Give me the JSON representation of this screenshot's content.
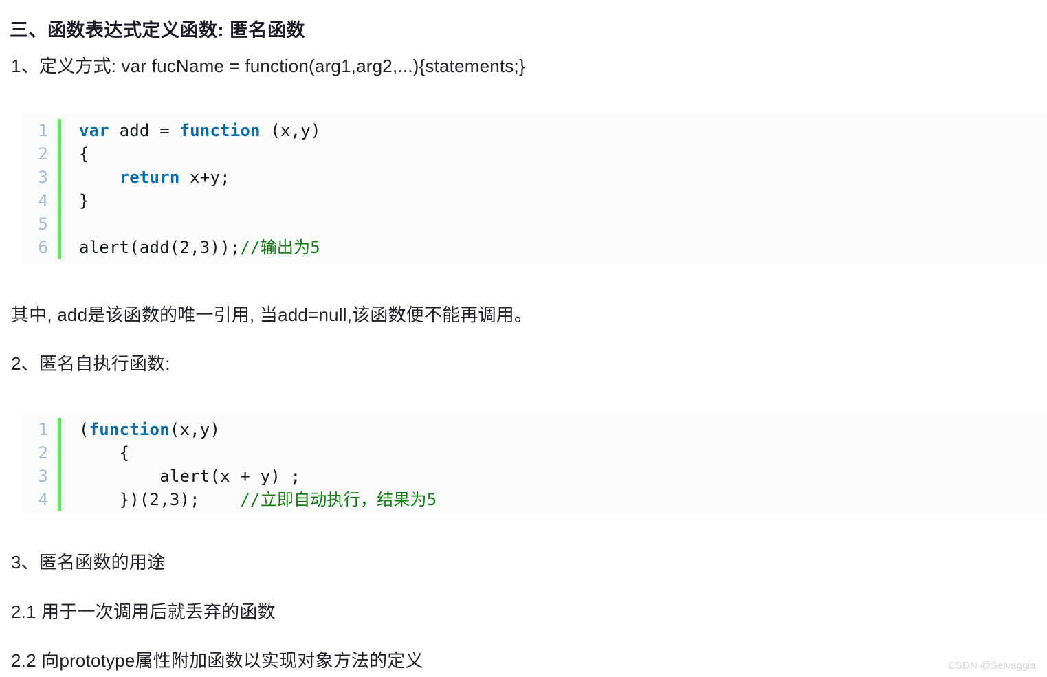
{
  "document": {
    "title": "三、函数表达式定义函数: 匿名函数",
    "paragraphs": {
      "definition_line": "1、定义方式: var fucName = function(arg1,arg2,...){statements;}",
      "note_line": "其中, add是该函数的唯一引用, 当add=null,该函数便不能再调用。",
      "section_2": "2、匿名自执行函数:",
      "section_3": "3、匿名函数的用途",
      "item_2_1": "2.1  用于一次调用后就丢弃的函数",
      "item_2_2": "2.2  向prototype属性附加函数以实现对象方法的定义"
    }
  },
  "code_block_1": {
    "language": "javascript",
    "line_numbers": [
      "1",
      "2",
      "3",
      "4",
      "5",
      "6"
    ],
    "lines": [
      {
        "num": "1",
        "kw1": "var",
        "rest1": " add = ",
        "kw2": "function",
        "rest2": " (x,y)"
      },
      {
        "num": "2",
        "plain": "{"
      },
      {
        "num": "3",
        "indent": "    ",
        "kw1": "return",
        "rest1": " x+y;"
      },
      {
        "num": "4",
        "plain": "}"
      },
      {
        "num": "5",
        "plain": ""
      },
      {
        "num": "6",
        "plain": "alert(add(2,3));",
        "comment": "//输出为5"
      }
    ]
  },
  "code_block_2": {
    "language": "javascript",
    "line_numbers": [
      "1",
      "2",
      "3",
      "4"
    ],
    "lines": [
      {
        "num": "1",
        "pre": "(",
        "kw1": "function",
        "rest1": "(x,y)"
      },
      {
        "num": "2",
        "plain": "    {"
      },
      {
        "num": "3",
        "plain": "        alert(x + y) ;"
      },
      {
        "num": "4",
        "plain": "    })(2,3);    ",
        "comment": "//立即自动执行，结果为5"
      }
    ]
  },
  "watermark": {
    "text": "CSDN @Selvaggia"
  },
  "colors": {
    "keyword": "#0b6aa8",
    "comment": "#128012",
    "gutter_bar": "#6adf68",
    "line_number": "#a6bcd0",
    "code_background": "#fafbfb",
    "body_text": "#1f2328",
    "watermark": "#d6d6d6"
  }
}
